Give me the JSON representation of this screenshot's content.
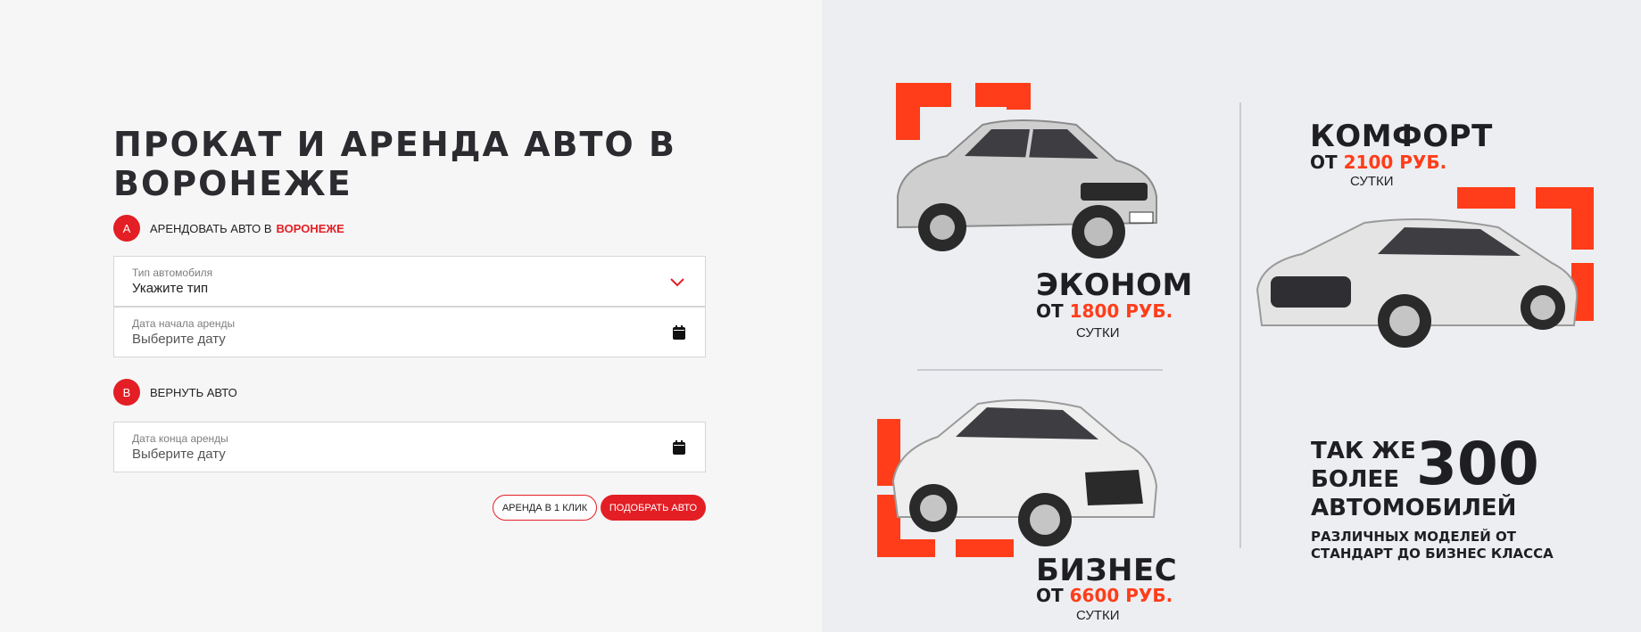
{
  "hero": {
    "title": "ПРОКАТ И АРЕНДА АВТО В ВОРОНЕЖЕ"
  },
  "step_a": {
    "badge": "A",
    "label": "АРЕНДОВАТЬ АВТО В",
    "city": "ВОРОНЕЖЕ"
  },
  "fields": {
    "car_type": {
      "label": "Тип автомобиля",
      "value": "Укажите тип"
    },
    "start_date": {
      "label": "Дата начала аренды",
      "placeholder": "Выберите дату"
    },
    "end_date": {
      "label": "Дата конца аренды",
      "placeholder": "Выберите дату"
    }
  },
  "step_b": {
    "badge": "B",
    "label": "ВЕРНУТЬ АВТО"
  },
  "buttons": {
    "one_click": "АРЕНДА В 1 КЛИК",
    "pick_car": "ПОДОБРАТЬ АВТО"
  },
  "promo": {
    "econom": {
      "name": "ЭКОНОМ",
      "price_prefix": "ОТ",
      "price": "1800 РУБ.",
      "unit": "СУТКИ"
    },
    "comfort": {
      "name": "КОМФОРТ",
      "price_prefix": "ОТ",
      "price": "2100 РУБ.",
      "unit": "СУТКИ"
    },
    "business": {
      "name": "БИЗНЕС",
      "price_prefix": "ОТ",
      "price": "6600 РУБ.",
      "unit": "СУТКИ"
    },
    "more": {
      "line1": "ТАК ЖЕ",
      "line2": "БОЛЕЕ",
      "number": "300",
      "line3": "АВТОМОБИЛЕЙ",
      "sub": "РАЗЛИЧНЫХ МОДЕЛЕЙ ОТ СТАНДАРТ ДО БИЗНЕС КЛАССА"
    }
  },
  "colors": {
    "accent": "#e31e24",
    "promo_accent": "#ff3d1a"
  },
  "icons": {
    "dropdown": "chevron-down-icon",
    "calendar": "calendar-icon"
  }
}
